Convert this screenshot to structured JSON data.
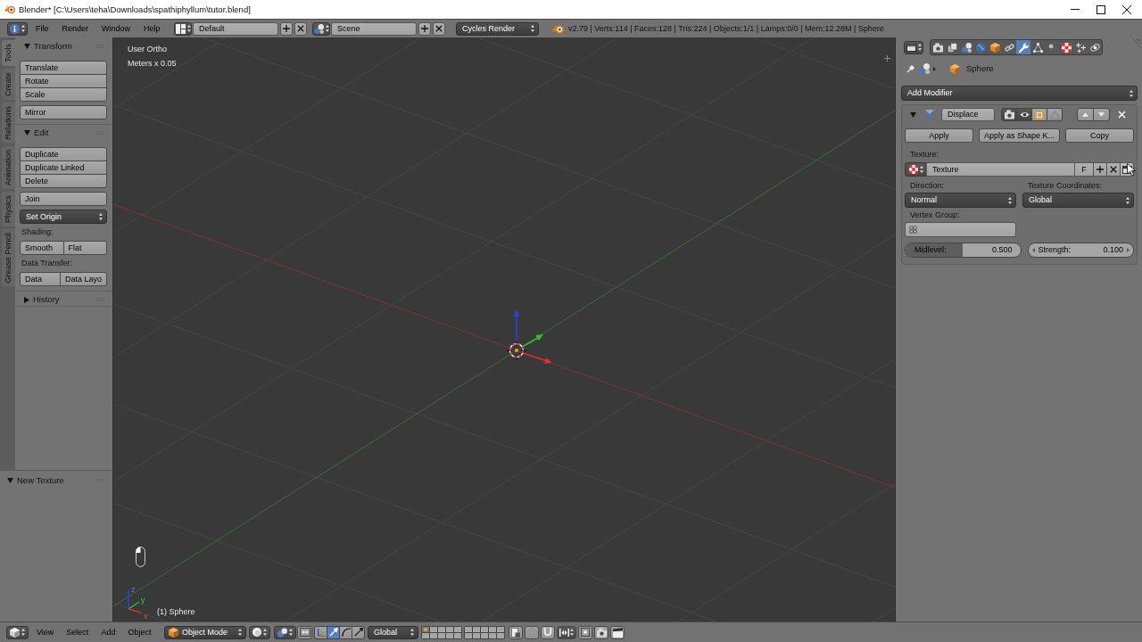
{
  "window": {
    "title": "Blender* [C:\\Users\\teha\\Downloads\\spathiphyllum\\tutor.blend]"
  },
  "info_header": {
    "menus": [
      "File",
      "Render",
      "Window",
      "Help"
    ],
    "screen_layout": "Default",
    "scene": "Scene",
    "render_engine": "Cycles Render",
    "stats": "v2.79 | Verts:114 | Faces:128 | Tris:224 | Objects:1/1 | Lamps:0/0 | Mem:12.28M | Sphere"
  },
  "tool_shelf": {
    "tabs": [
      {
        "label": "Tools",
        "selected": true
      },
      {
        "label": "Create",
        "selected": false
      },
      {
        "label": "Relations",
        "selected": false
      },
      {
        "label": "Animation",
        "selected": false
      },
      {
        "label": "Physics",
        "selected": false
      },
      {
        "label": "Grease Pencil",
        "selected": false
      }
    ],
    "panels": [
      {
        "title": "Transform",
        "expanded": true,
        "items": [
          {
            "kind": "stack",
            "buttons": [
              "Translate",
              "Rotate",
              "Scale"
            ]
          },
          {
            "kind": "stack",
            "buttons": [
              "Mirror"
            ]
          }
        ]
      },
      {
        "title": "Edit",
        "expanded": true,
        "items": [
          {
            "kind": "stack",
            "buttons": [
              "Duplicate",
              "Duplicate Linked",
              "Delete"
            ]
          },
          {
            "kind": "stack",
            "buttons": [
              "Join"
            ]
          },
          {
            "kind": "menu",
            "label": "Set Origin"
          },
          {
            "kind": "label",
            "text": "Shading:"
          },
          {
            "kind": "row",
            "buttons": [
              "Smooth",
              "Flat"
            ]
          },
          {
            "kind": "label",
            "text": "Data Transfer:"
          },
          {
            "kind": "row",
            "buttons": [
              "Data",
              "Data Layo"
            ]
          }
        ]
      },
      {
        "title": "History",
        "expanded": false
      }
    ]
  },
  "operator_panel": {
    "title": "New Texture",
    "expanded": true
  },
  "viewport": {
    "view_name": "User Ortho",
    "units": "Meters x 0.05",
    "object_info": "(1) Sphere",
    "axis_labels": [
      "z",
      "y",
      "x"
    ]
  },
  "properties": {
    "tabs": [
      {
        "kind": "render",
        "selected": false
      },
      {
        "kind": "render_layers",
        "selected": false
      },
      {
        "kind": "scene",
        "selected": false
      },
      {
        "kind": "world",
        "selected": false
      },
      {
        "kind": "object",
        "selected": false
      },
      {
        "kind": "constraints",
        "selected": false
      },
      {
        "kind": "modifiers",
        "selected": true
      },
      {
        "kind": "data",
        "selected": false
      },
      {
        "kind": "material",
        "selected": false
      },
      {
        "kind": "texture",
        "selected": false
      },
      {
        "kind": "particles",
        "selected": false
      },
      {
        "kind": "physics",
        "selected": false
      }
    ],
    "object_name": "Sphere",
    "add_modifier": "Add Modifier",
    "modifier": {
      "name": "Displace",
      "expanded": true,
      "toggles": [
        {
          "kind": "render",
          "on": true
        },
        {
          "kind": "viewport",
          "on": true
        },
        {
          "kind": "editmode",
          "on": false
        },
        {
          "kind": "cage",
          "on": false
        }
      ],
      "actions": [
        "Apply",
        "Apply as Shape K...",
        "Copy"
      ],
      "texture_label": "Texture:",
      "texture": "Texture",
      "fake_user": "F",
      "direction_label": "Direction:",
      "direction": "Normal",
      "coordinates_label": "Texture Coordinates:",
      "coordinates": "Global",
      "vertex_group_label": "Vertex Group:",
      "midlevel": {
        "label": "Midlevel:",
        "value": "0.500",
        "level": 0.5
      },
      "strength": {
        "label": "Strength:",
        "value": "0.100"
      }
    }
  },
  "view3d_header": {
    "menus": [
      "View",
      "Select",
      "Add",
      "Object"
    ],
    "mode": "Object Mode",
    "orientation": "Global",
    "manipulators": [
      {
        "kind": "axes",
        "selected": false
      },
      {
        "kind": "translate",
        "selected": true
      },
      {
        "kind": "rotate",
        "selected": false
      },
      {
        "kind": "scale",
        "selected": false
      }
    ],
    "layers": [
      {
        "selected": true
      },
      {
        "selected": false
      },
      {
        "selected": false
      },
      {
        "selected": false
      },
      {
        "selected": false
      },
      {
        "selected": false
      },
      {
        "selected": false
      },
      {
        "selected": false
      },
      {
        "selected": false
      },
      {
        "selected": false
      },
      {
        "selected": false
      },
      {
        "selected": false
      },
      {
        "selected": false
      },
      {
        "selected": false
      },
      {
        "selected": false
      },
      {
        "selected": false
      },
      {
        "selected": false
      },
      {
        "selected": false
      },
      {
        "selected": false
      },
      {
        "selected": false
      }
    ]
  }
}
